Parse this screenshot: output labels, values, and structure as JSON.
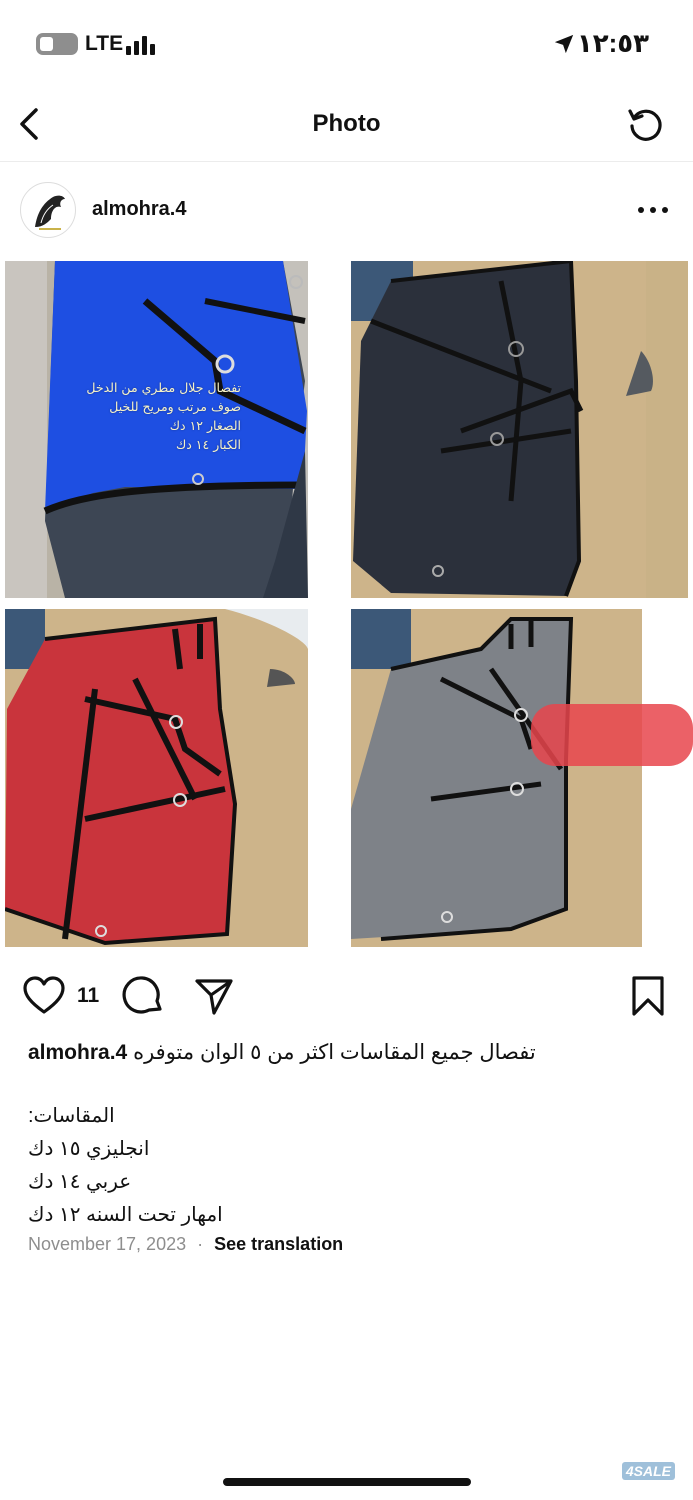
{
  "status_bar": {
    "network": "LTE",
    "time": "١٢:٥٣"
  },
  "nav": {
    "title": "Photo"
  },
  "post": {
    "username": "almohra.4",
    "image_overlay_text": [
      "تفصال جلال مطري من الدخل",
      "صوف مرتب ومريح للخيل",
      "الصغار ١٢ دك",
      "الكبار ١٤ دك"
    ],
    "likes": "11",
    "caption_username": "almohra.4",
    "caption_text": "تفصال جميع المقاسات اكثر من ٥ الوان متوفره",
    "sizes_lines": [
      "المقاسات:",
      "انجليزي ١٥ دك",
      "عربي ١٤ دك",
      "امهار تحت السنه ١٢ دك"
    ],
    "date": "November 17, 2023",
    "separator": "·",
    "see_translation": "See translation"
  },
  "watermark": "4SALE",
  "colors": {
    "blanket_blue": "#1f4fe0",
    "blanket_black": "#2a2f3a",
    "blanket_red": "#c9343c",
    "blanket_grey": "#7e8288",
    "floor_wood": "#cdb48a"
  },
  "icons": [
    "battery-icon",
    "signal-icon",
    "location-arrow-icon",
    "back-chevron-icon",
    "refresh-icon",
    "more-icon",
    "heart-icon",
    "comment-icon",
    "share-icon",
    "bookmark-icon"
  ]
}
